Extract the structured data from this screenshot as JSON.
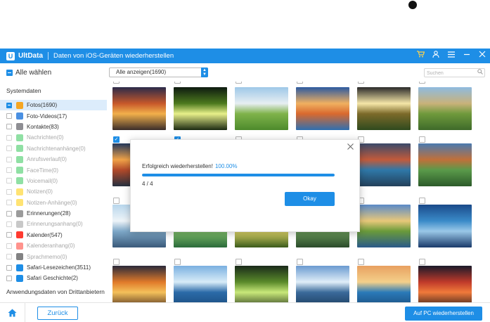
{
  "app": {
    "name": "UltData",
    "logo_letter": "U",
    "window_title": "Daten von iOS-Geräten wiederherstellen",
    "accent": "#1e8ee6"
  },
  "titlebar_icons": [
    "cart-icon",
    "user-icon",
    "menu-icon",
    "minimize-icon",
    "close-icon"
  ],
  "toolbar": {
    "select_all_label": "Alle wählen",
    "filter_value": "Alle anzeigen(1690)",
    "search_placeholder": "Suchen"
  },
  "sidebar": {
    "system_title": "Systemdaten",
    "items": [
      {
        "label": "Fotos(1690)",
        "state": "partial",
        "enabled": true,
        "active": true,
        "icon": "photos-icon",
        "color": "#f5a623"
      },
      {
        "label": "Foto-Videos(17)",
        "state": "empty",
        "enabled": true,
        "active": false,
        "icon": "video-icon",
        "color": "#4a90e2"
      },
      {
        "label": "Kontakte(83)",
        "state": "empty",
        "enabled": true,
        "active": false,
        "icon": "contacts-icon",
        "color": "#8e8e93"
      },
      {
        "label": "Nachrichten(0)",
        "state": "empty",
        "enabled": false,
        "active": false,
        "icon": "messages-icon",
        "color": "#34c759"
      },
      {
        "label": "Nachrichtenanhänge(0)",
        "state": "empty",
        "enabled": false,
        "active": false,
        "icon": "attachment-icon",
        "color": "#34c759"
      },
      {
        "label": "Anrufsverlauf(0)",
        "state": "empty",
        "enabled": false,
        "active": false,
        "icon": "phone-icon",
        "color": "#34c759"
      },
      {
        "label": "FaceTime(0)",
        "state": "empty",
        "enabled": false,
        "active": false,
        "icon": "facetime-icon",
        "color": "#34c759"
      },
      {
        "label": "Voicemail(0)",
        "state": "empty",
        "enabled": false,
        "active": false,
        "icon": "voicemail-icon",
        "color": "#34c759"
      },
      {
        "label": "Notizen(0)",
        "state": "empty",
        "enabled": false,
        "active": false,
        "icon": "notes-icon",
        "color": "#ffcc00"
      },
      {
        "label": "Notizen-Anhänge(0)",
        "state": "empty",
        "enabled": false,
        "active": false,
        "icon": "notes-attachment-icon",
        "color": "#ffcc00"
      },
      {
        "label": "Erinnerungen(28)",
        "state": "empty",
        "enabled": true,
        "active": false,
        "icon": "reminders-icon",
        "color": "#9b9b9b"
      },
      {
        "label": "Erinnerungsanhang(0)",
        "state": "empty",
        "enabled": false,
        "active": false,
        "icon": "reminders-attachment-icon",
        "color": "#9b9b9b"
      },
      {
        "label": "Kalender(547)",
        "state": "empty",
        "enabled": true,
        "active": false,
        "icon": "calendar-icon",
        "color": "#ff3b30"
      },
      {
        "label": "Kalenderanhang(0)",
        "state": "empty",
        "enabled": false,
        "active": false,
        "icon": "calendar-attachment-icon",
        "color": "#ff3b30"
      },
      {
        "label": "Sprachmemo(0)",
        "state": "empty",
        "enabled": false,
        "active": false,
        "icon": "voice-memo-icon",
        "color": "#1c1c1e"
      },
      {
        "label": "Safari-Lesezeichen(3511)",
        "state": "empty",
        "enabled": true,
        "active": false,
        "icon": "safari-bookmarks-icon",
        "color": "#1e8ee6"
      },
      {
        "label": "Safari Geschichte(2)",
        "state": "empty",
        "enabled": true,
        "active": false,
        "icon": "safari-history-icon",
        "color": "#1e8ee6"
      }
    ],
    "third_party_title": "Anwendungsdaten von Drittanbietern"
  },
  "photos": [
    {
      "checked": false,
      "colors": [
        "#2b2a4a",
        "#c7582a",
        "#f2b04b",
        "#3a2d2a"
      ]
    },
    {
      "checked": false,
      "colors": [
        "#0d1a10",
        "#4d7a1e",
        "#e8f08a",
        "#1b2a12"
      ]
    },
    {
      "checked": false,
      "colors": [
        "#9ec8e8",
        "#e7eef2",
        "#7fb34a",
        "#4d8a2c"
      ]
    },
    {
      "checked": false,
      "colors": [
        "#2c5aa0",
        "#f0b060",
        "#d9692e",
        "#2f6fb0"
      ]
    },
    {
      "checked": false,
      "colors": [
        "#2a2a2a",
        "#f5e6a8",
        "#7c6a2a",
        "#2f4a1e"
      ]
    },
    {
      "checked": false,
      "colors": [
        "#8fbbe0",
        "#c9b27a",
        "#6f9a3c",
        "#3f6a2a"
      ]
    },
    {
      "checked": true,
      "colors": [
        "#23385c",
        "#f0a248",
        "#b24a2a",
        "#25303f"
      ]
    },
    {
      "checked": true,
      "colors": [
        "#2a4a2a",
        "#6e8f3a",
        "#c7d27a",
        "#345a2a"
      ]
    },
    {
      "checked": false,
      "colors": [
        "#6aa0d8",
        "#dbe6ee",
        "#a8c77a",
        "#5c8a3a"
      ]
    },
    {
      "checked": false,
      "colors": [
        "#1c3a6a",
        "#b65a3a",
        "#2e6a9a",
        "#1a2a4a"
      ]
    },
    {
      "checked": false,
      "colors": [
        "#3a4a6a",
        "#c25a3a",
        "#2f78a8",
        "#23405a"
      ]
    },
    {
      "checked": false,
      "colors": [
        "#4a7ab0",
        "#c0703a",
        "#5a9a4a",
        "#2c5a2a"
      ]
    },
    {
      "checked": false,
      "colors": [
        "#b8d6ec",
        "#eef4f8",
        "#7ea8c8",
        "#3a5a7a"
      ]
    },
    {
      "checked": false,
      "colors": [
        "#1a5aa8",
        "#5aa0e0",
        "#7fbf6a",
        "#2a6a3a"
      ]
    },
    {
      "checked": false,
      "colors": [
        "#2a3a1a",
        "#7a9a2a",
        "#e0d86a",
        "#3a5a1a"
      ]
    },
    {
      "checked": false,
      "colors": [
        "#1e4a8a",
        "#3a7ab8",
        "#6a9a5a",
        "#2a4a2a"
      ]
    },
    {
      "checked": false,
      "colors": [
        "#5a8ac8",
        "#e8c87a",
        "#6a9a3a",
        "#2a5a8a"
      ]
    },
    {
      "checked": false,
      "colors": [
        "#1a4a8a",
        "#3a8ac8",
        "#9ac8e8",
        "#1a3a6a"
      ]
    },
    {
      "checked": false,
      "colors": [
        "#2a2a3a",
        "#e07a2a",
        "#f4c05a",
        "#4a2a1a"
      ]
    },
    {
      "checked": false,
      "colors": [
        "#7ab0e0",
        "#d8ecf8",
        "#2a6aa8",
        "#1a4a7a"
      ]
    },
    {
      "checked": false,
      "colors": [
        "#1a2a1a",
        "#5a8a2a",
        "#c8e87a",
        "#2a3a1a"
      ]
    },
    {
      "checked": false,
      "colors": [
        "#6a9ad0",
        "#e0eef8",
        "#3a6a9a",
        "#1a3a5a"
      ]
    },
    {
      "checked": false,
      "colors": [
        "#e8a060",
        "#f4d08a",
        "#2a7ab8",
        "#1a4a7a"
      ]
    },
    {
      "checked": false,
      "colors": [
        "#1a1a2a",
        "#c03a2a",
        "#f07a3a",
        "#2a1a1a"
      ]
    }
  ],
  "dialog": {
    "message": "Erfolgreich wiederherstellen!",
    "percent_text": "100.00%",
    "progress": 1.0,
    "count": "4 / 4",
    "ok_label": "Okay",
    "close_icon": "close-icon"
  },
  "bottom": {
    "home_icon": "home-icon",
    "back_label": "Zurück",
    "recover_label": "Auf PC wiederherstellen"
  }
}
